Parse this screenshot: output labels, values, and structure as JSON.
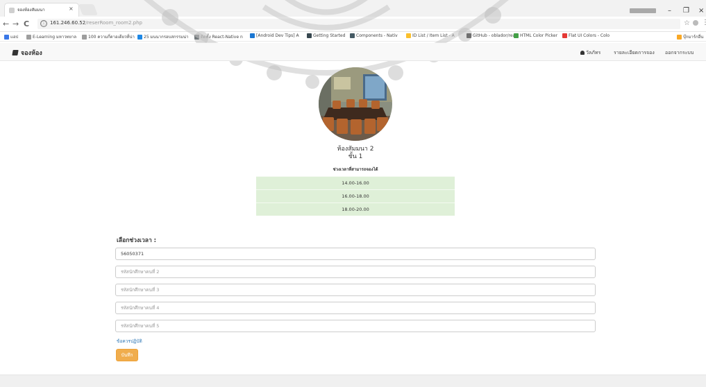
{
  "browser": {
    "tab_title": "จองห้องสัมมนา",
    "tab_close": "×",
    "window_controls": [
      "–",
      "❐",
      "×"
    ],
    "url_host": "161.246.60.52",
    "url_path": "/reserRoom_room2.php",
    "info_icon": "ⓘ",
    "nav_back": "←",
    "nav_forward": "→",
    "nav_reload": "C",
    "star": "☆",
    "menu": "⋮",
    "bookmarks": [
      {
        "label": "แอป",
        "icon": "apps-icon",
        "color": "#3b78e7"
      },
      {
        "label": "E-Learning มหาวทยาล",
        "icon": "page-icon",
        "color": "#9e9e9e"
      },
      {
        "label": "100 ความกี่ดาอเดียวที่น่า",
        "icon": "page-icon",
        "color": "#9e9e9e"
      },
      {
        "label": "25 มนนากรอบสกรรมน่า",
        "icon": "site-icon",
        "color": "#1e88e5"
      },
      {
        "label": "ติดตั้ง React-Native n",
        "icon": "site-icon",
        "color": "#263238"
      },
      {
        "label": "[Android Dev Tips] A",
        "icon": "site-icon",
        "color": "#1976d2"
      },
      {
        "label": "Getting Started",
        "icon": "site-icon",
        "color": "#37474f"
      },
      {
        "label": "Components - Nativ",
        "icon": "site-icon",
        "color": "#455a64"
      },
      {
        "label": "ID List / Item List - A",
        "icon": "site-icon",
        "color": "#fbc02d"
      },
      {
        "label": "GitHub - oblador/rea",
        "icon": "github-icon",
        "color": "#212121"
      },
      {
        "label": "HTML Color Picker",
        "icon": "site-icon",
        "color": "#43a047"
      },
      {
        "label": "Flat UI Colors - Colo",
        "icon": "site-icon",
        "color": "#e53935"
      },
      {
        "label": "บุ๊กมาร์กอื่น",
        "icon": "folder-icon",
        "color": "#f9a825"
      }
    ]
  },
  "navbar": {
    "brand": "จองห้อง",
    "user": "วัลภัทร",
    "links": [
      "รายละเอียดการจอง",
      "ออกจากระบบ"
    ]
  },
  "room": {
    "name": "ห้องสัมมนา 2",
    "floor": "ชั้น 1",
    "slots_heading": "ช่วงเวลาที่สามารถจองได้",
    "slots": [
      "14.00-16.00",
      "16.00-18.00",
      "18.00-20.00"
    ]
  },
  "form": {
    "label": "เลือกช่วงเวลา :",
    "fields": [
      {
        "value": "56050371",
        "placeholder": ""
      },
      {
        "value": "",
        "placeholder": "รหัสนักศึกษาคนที่ 2"
      },
      {
        "value": "",
        "placeholder": "รหัสนักศึกษาคนที่ 3"
      },
      {
        "value": "",
        "placeholder": "รหัสนักศึกษาคนที่ 4"
      },
      {
        "value": "",
        "placeholder": "รหัสนักศึกษาคนที่ 5"
      }
    ],
    "terms_link": "ข้อควรปฏิบัติ",
    "save_label": "บันทึก"
  },
  "colors": {
    "slot_bg": "#dff0d8",
    "save_bg": "#f0ad4e",
    "link": "#337ab7"
  }
}
